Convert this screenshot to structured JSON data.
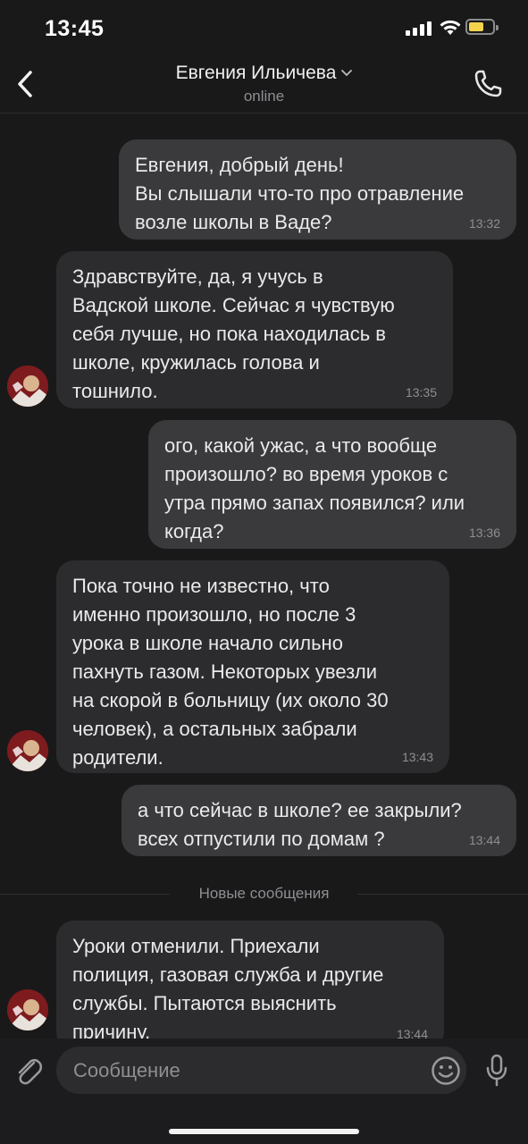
{
  "status_bar": {
    "time": "13:45"
  },
  "header": {
    "contact_name": "Евгения Ильичева",
    "status": "online"
  },
  "messages": [
    {
      "dir": "out",
      "text": "Евгения, добрый день!\nВы слышали что-то про отравление\nвозле школы в Ваде?",
      "time": "13:32"
    },
    {
      "dir": "in",
      "text": "Здравствуйте, да, я учусь в\nВадской школе. Сейчас я чувствую\nсебя лучше, но пока находилась в\nшколе, кружилась голова и\nтошнило.",
      "time": "13:35"
    },
    {
      "dir": "out",
      "text": "ого, какой ужас, а что вообще\nпроизошло? во время уроков с\nутра прямо запах появился? или\nкогда?",
      "time": "13:36"
    },
    {
      "dir": "in",
      "text": "Пока точно не известно, что\nименно произошло, но после 3\nурока в школе начало сильно\nпахнуть газом. Некоторых увезли\nна скорой в больницу (их около 30\nчеловек), а остальных забрали\nродители.",
      "time": "13:43"
    },
    {
      "dir": "out",
      "text": "а что сейчас в школе? ее закрыли?\nвсех отпустили по домам ?",
      "time": "13:44"
    },
    {
      "dir": "in",
      "text": "Уроки отменили. Приехали\nполиция, газовая служба и другие\nслужбы. Пытаются выяснить\nпричину.",
      "time": "13:44"
    }
  ],
  "divider": {
    "label": "Новые сообщения"
  },
  "composer": {
    "placeholder": "Сообщение"
  },
  "colors": {
    "background": "#19191a",
    "outgoing_bubble": "#3a3a3c",
    "incoming_bubble": "#2c2c2e",
    "battery": "#f2d34b"
  },
  "icons": [
    "back-chevron-icon",
    "chevron-down-icon",
    "phone-icon",
    "paperclip-icon",
    "emoji-icon",
    "microphone-icon",
    "signal-icon",
    "wifi-icon",
    "battery-icon"
  ]
}
